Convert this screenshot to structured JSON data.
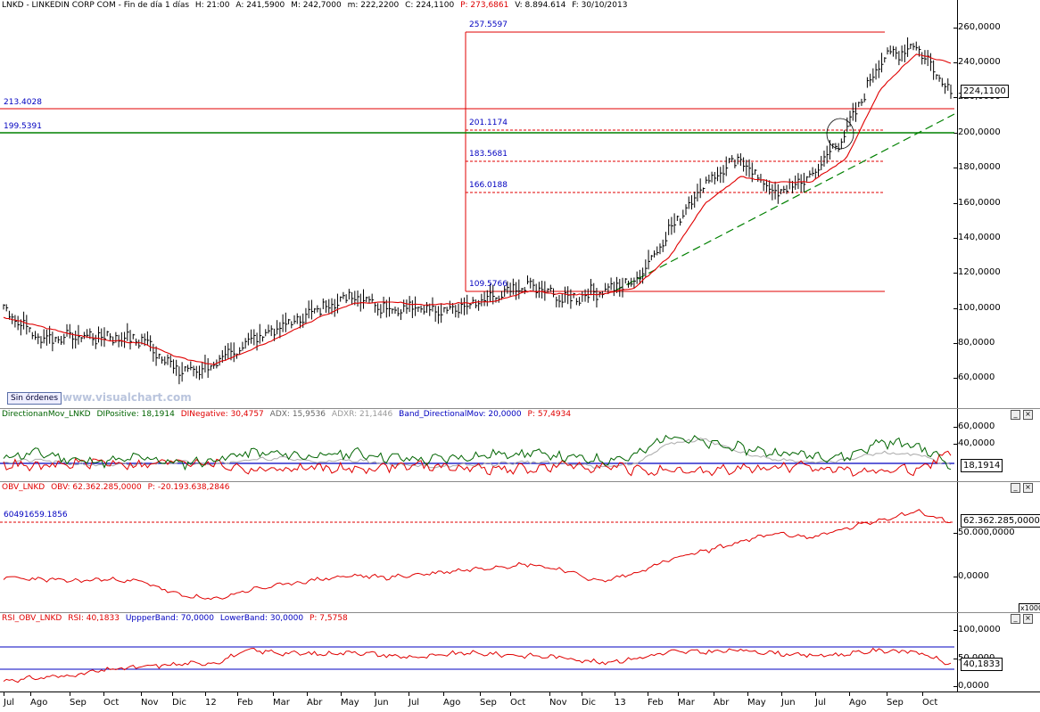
{
  "main": {
    "header": {
      "symbol": "LNKD - LINKEDIN CORP COM - Fin de día 1 días",
      "h": "H: 21:00",
      "a": "A: 241,5900",
      "m_high": "M: 242,7000",
      "m_low": "m: 222,2200",
      "c": "C: 224,1100",
      "p": "P: 273,6861",
      "v": "V: 8.894.614",
      "f": "F: 30/10/2013"
    },
    "y_ticks": [
      "260,0000",
      "240,0000",
      "220,0000",
      "200,0000",
      "180,0000",
      "160,0000",
      "140,0000",
      "120,0000",
      "100,0000",
      "80,0000",
      "60,0000"
    ],
    "last_value": "224,1100",
    "fib_labels": [
      "257.5597",
      "201.1174",
      "183.5681",
      "166.0188",
      "109.5766"
    ],
    "level_labels": [
      "213.4028",
      "199.5391"
    ],
    "badge": "Sin órdenes",
    "watermark": "www.visualchart.com"
  },
  "dmi": {
    "header": {
      "name": "DirectionanMov_LNKD",
      "dip": "DIPositive: 18,1914",
      "din": "DINegative: 30,4757",
      "adx": "ADX: 15,9536",
      "adxr": "ADXR: 21,1446",
      "band": "Band_DirectionalMov: 20,0000",
      "p": "P: 57,4934"
    },
    "y_ticks": [
      "60,0000",
      "40,0000"
    ],
    "last_value": "18,1914"
  },
  "obv": {
    "header": {
      "name": "OBV_LNKD",
      "obv": "OBV: 62.362.285,0000",
      "p": "P: -20.193.638,2846"
    },
    "level_label": "60491659.1856",
    "y_ticks": [
      "50.000,0000",
      "0,0000"
    ],
    "last_value": "62.362.285,0000",
    "unit": "x1000"
  },
  "rsi": {
    "header": {
      "name": "RSI_OBV_LNKD",
      "rsi": "RSI: 40,1833",
      "upper": "UppperBand: 70,0000",
      "lower": "LowerBand: 30,0000",
      "p": "P: 7,5758"
    },
    "y_ticks": [
      "100,0000",
      "50,0000",
      "0,0000"
    ],
    "last_value": "40,1833"
  },
  "x_labels": [
    "Jul",
    "Ago",
    "Sep",
    "Oct",
    "Nov",
    "Dic",
    "12",
    "Feb",
    "Mar",
    "Abr",
    "May",
    "Jun",
    "Jul",
    "Ago",
    "Sep",
    "Oct",
    "Nov",
    "Dic",
    "13",
    "Feb",
    "Mar",
    "Abr",
    "May",
    "Jun",
    "Jul",
    "Ago",
    "Sep",
    "Oct"
  ],
  "colors": {
    "price": "#000000",
    "ma": "#e00000",
    "fib": "#e00000",
    "level_green": "#008000",
    "trend": "#008000",
    "dip": "#006400",
    "din": "#e00000",
    "band": "#0000c0",
    "obv": "#e00000",
    "rsi": "#e00000"
  },
  "chart_data": [
    {
      "type": "line",
      "title": "LNKD - LINKEDIN CORP COM - Fin de día 1 días",
      "x": [
        "Jul",
        "Ago",
        "Sep",
        "Oct",
        "Nov",
        "Dic",
        "12",
        "Feb",
        "Mar",
        "Abr",
        "May",
        "Jun",
        "Jul",
        "Ago",
        "Sep",
        "Oct",
        "Nov",
        "Dic",
        "13",
        "Feb",
        "Mar",
        "Abr",
        "May",
        "Jun",
        "Jul",
        "Ago",
        "Sep",
        "Oct"
      ],
      "ylim": [
        50,
        265
      ],
      "series": [
        {
          "values": [
            100,
            83,
            84,
            84,
            82,
            64,
            67,
            82,
            90,
            100,
            108,
            100,
            100,
            100,
            106,
            113,
            105,
            110,
            115,
            145,
            172,
            185,
            165,
            175,
            200,
            242,
            250,
            224
          ]
        },
        {
          "values": [
            95,
            90,
            85,
            82,
            80,
            72,
            68,
            76,
            85,
            95,
            103,
            104,
            102,
            103,
            104,
            110,
            108,
            108,
            112,
            130,
            160,
            175,
            172,
            172,
            185,
            225,
            245,
            240
          ]
        }
      ],
      "levels": [
        257.5597,
        213.4028,
        201.1174,
        199.5391,
        183.5681,
        166.0188,
        109.5766
      ]
    },
    {
      "type": "line",
      "series": [
        {
          "name": "DIPositive",
          "values": [
            25,
            30,
            22,
            20,
            25,
            18,
            22,
            30,
            28,
            26,
            30,
            25,
            22,
            25,
            28,
            30,
            25,
            22,
            26,
            50,
            40,
            35,
            30,
            28,
            25,
            42,
            38,
            18
          ]
        },
        {
          "name": "DINegative",
          "values": [
            18,
            14,
            18,
            20,
            16,
            22,
            18,
            12,
            12,
            14,
            12,
            15,
            16,
            14,
            12,
            12,
            16,
            15,
            12,
            8,
            10,
            12,
            14,
            14,
            12,
            10,
            12,
            30
          ]
        },
        {
          "name": "ADX",
          "values": [
            20,
            22,
            18,
            16,
            18,
            20,
            18,
            22,
            24,
            20,
            22,
            18,
            15,
            16,
            18,
            20,
            18,
            15,
            18,
            40,
            45,
            30,
            22,
            20,
            22,
            30,
            28,
            16
          ]
        }
      ],
      "ylim": [
        0,
        65
      ],
      "band": 20
    },
    {
      "type": "line",
      "series": [
        {
          "name": "OBV",
          "values": [
            0,
            -2,
            -4,
            -2,
            -5,
            -20,
            -25,
            -14,
            -8,
            -2,
            2,
            0,
            4,
            8,
            12,
            15,
            8,
            -5,
            5,
            20,
            30,
            40,
            50,
            45,
            55,
            65,
            75,
            62
          ]
        }
      ],
      "ylim": [
        -30,
        85
      ],
      "level": 60.49
    },
    {
      "type": "line",
      "series": [
        {
          "name": "RSI",
          "values": [
            10,
            15,
            20,
            30,
            35,
            40,
            42,
            65,
            60,
            58,
            62,
            55,
            52,
            60,
            58,
            55,
            52,
            42,
            50,
            62,
            62,
            65,
            60,
            55,
            58,
            65,
            62,
            40
          ]
        }
      ],
      "ylim": [
        0,
        100
      ],
      "bands": [
        70,
        30
      ]
    }
  ]
}
